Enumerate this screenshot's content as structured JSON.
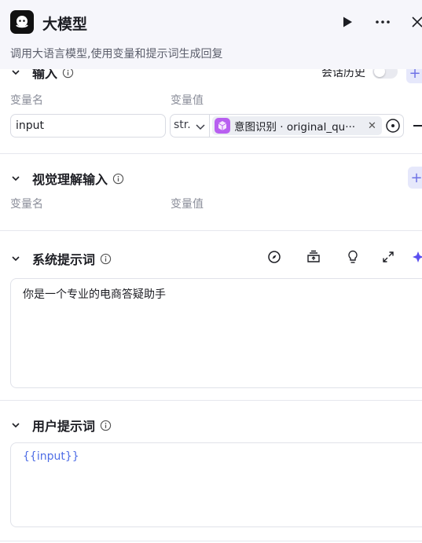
{
  "header": {
    "title": "大模型",
    "description": "调用大语言模型,使用变量和提示词生成回复"
  },
  "input_section": {
    "title": "输入",
    "history_label": "会话历史",
    "history_enabled": false,
    "col_name": "变量名",
    "col_value": "变量值",
    "rows": [
      {
        "name": "input",
        "type": "str.",
        "ref": "意图识别 · original_qu···"
      }
    ]
  },
  "visual_section": {
    "title": "视觉理解输入",
    "col_name": "变量名",
    "col_value": "变量值"
  },
  "system_prompt": {
    "title": "系统提示词",
    "content": "你是一个专业的电商答疑助手"
  },
  "user_prompt": {
    "title": "用户提示词",
    "content": "{{input}}"
  },
  "colors": {
    "accent": "#6f73e6",
    "tag_icon": "#b85ff0",
    "template_var": "#4f6ee6"
  },
  "icons": [
    "node-logo-icon",
    "run-icon",
    "more-icon",
    "close-icon",
    "chevron-down-icon",
    "info-icon",
    "compass-icon",
    "library-icon",
    "bulb-icon",
    "expand-icon",
    "ai-sparkle-icon",
    "clear-icon",
    "target-icon",
    "minus-icon",
    "plus-icon"
  ]
}
